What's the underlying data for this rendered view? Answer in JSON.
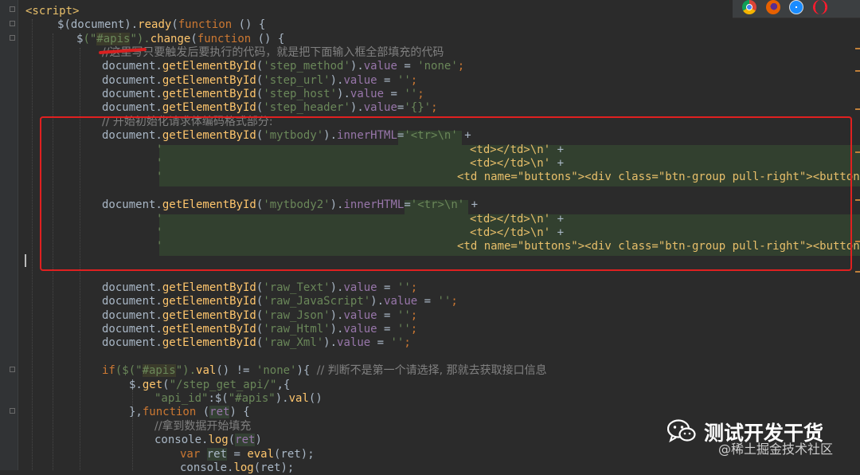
{
  "code": {
    "l1": {
      "tag": "<script>"
    },
    "l2": {
      "dollar": "$",
      "a": "(document).",
      "ready": "ready",
      "b": "(",
      "kw": "function",
      "c": " () {"
    },
    "l3": {
      "dollar": "$",
      "a": "(\"",
      "sel": "#apis",
      "b": "\").",
      "change": "change",
      "c": "(",
      "kw": "function",
      "d": " () {"
    },
    "l4": {
      "cmt": "//这里写只要触发后要执行的代码，就是把下面输入框全部填充的代码"
    },
    "l5": {
      "a": "document.",
      "fn": "getElementById",
      "b": "(",
      "s1": "'step_method'",
      "c": ").",
      "p": "value",
      "d": " = ",
      "s2": "'none'",
      "e": ";"
    },
    "l6": {
      "a": "document.",
      "fn": "getElementById",
      "b": "(",
      "s1": "'step_url'",
      "c": ").",
      "p": "value",
      "d": " = ",
      "s2": "''",
      "e": ";"
    },
    "l7": {
      "a": "document.",
      "fn": "getElementById",
      "b": "(",
      "s1": "'step_host'",
      "c": ").",
      "p": "value",
      "d": " = ",
      "s2": "''",
      "e": ";"
    },
    "l8": {
      "a": "document.",
      "fn": "getElementById",
      "b": "(",
      "s1": "'step_header'",
      "c": ").",
      "p": "value",
      "d": "=",
      "s2": "'{}'",
      "e": ";"
    },
    "l9": {
      "cmt": "// 开始初始化请求体编码格式部分:"
    },
    "l10": {
      "a": "document.",
      "fn": "getElementById",
      "b": "(",
      "s1": "'mytbody'",
      "c": ").",
      "p": "innerHTML",
      "d": "=",
      "s2": "'<tr>\\n'",
      "e": " +"
    },
    "l11": {
      "q": "'",
      "t": "<td></td>\\n'",
      "e": " +"
    },
    "l12": {
      "q": "'",
      "t": "<td></td>\\n'",
      "e": " +"
    },
    "l13": {
      "q": "'",
      "t": "<td name=\"buttons\"><div class=\"btn-group pull-right\"><button ic"
    },
    "l14": {
      "a": "document.",
      "fn": "getElementById",
      "b": "(",
      "s1": "'mytbody2'",
      "c": ").",
      "p": "innerHTML",
      "d": "=",
      "s2": "'<tr>\\n'",
      "e": " +"
    },
    "l15": {
      "q": "'",
      "t": "<td></td>\\n'",
      "e": " +"
    },
    "l16": {
      "q": "'",
      "t": "<td></td>\\n'",
      "e": " +"
    },
    "l17": {
      "q": "'",
      "t": "<td name=\"buttons\"><div class=\"btn-group pull-right\"><button ic"
    },
    "l18": {
      "a": "document.",
      "fn": "getElementById",
      "b": "(",
      "s1": "'raw_Text'",
      "c": ").",
      "p": "value",
      "d": " = ",
      "s2": "''",
      "e": ";"
    },
    "l19": {
      "a": "document.",
      "fn": "getElementById",
      "b": "(",
      "s1": "'raw_JavaScript'",
      "c": ").",
      "p": "value",
      "d": " = ",
      "s2": "''",
      "e": ";"
    },
    "l20": {
      "a": "document.",
      "fn": "getElementById",
      "b": "(",
      "s1": "'raw_Json'",
      "c": ").",
      "p": "value",
      "d": " = ",
      "s2": "''",
      "e": ";"
    },
    "l21": {
      "a": "document.",
      "fn": "getElementById",
      "b": "(",
      "s1": "'raw_Html'",
      "c": ").",
      "p": "value",
      "d": " = ",
      "s2": "''",
      "e": ";"
    },
    "l22": {
      "a": "document.",
      "fn": "getElementById",
      "b": "(",
      "s1": "'raw_Xml'",
      "c": ").",
      "p": "value",
      "d": " = ",
      "s2": "''",
      "e": ";"
    },
    "l23": {
      "kw": "if",
      "a": "($(\"",
      "sel": "#apis",
      "b": "\").",
      "fn": "val",
      "c": "() != ",
      "s": "'none'",
      "d": "){ ",
      "cmt": "// 判断不是第一个请选择, 那就去获取接口信息"
    },
    "l24": {
      "a": "$.",
      "fn": "get",
      "b": "(",
      "s": "\"/step_get_api/\"",
      "c": ",{"
    },
    "l25": {
      "s1": "\"api_id\"",
      "a": ":$(",
      "s2": "\"#apis\"",
      "b": ").",
      "fn": "val",
      "c": "()"
    },
    "l26": {
      "a": "},",
      "kw": "function",
      "b": " (",
      "v": "ret",
      "c": ") {"
    },
    "l27": {
      "cmt": "//拿到数据开始填充"
    },
    "l28": {
      "a": "console.",
      "fn": "log",
      "b": "(",
      "v": "ret",
      "c": ")"
    },
    "l29": {
      "kw": "var",
      "sp": " ",
      "v": "ret",
      "a": " = ",
      "fn": "eval",
      "b": "(ret);"
    },
    "l30": {
      "a": "console.",
      "fn": "log",
      "b": "(ret);"
    }
  },
  "browser_icons": [
    "chrome-icon",
    "firefox-icon",
    "safari-icon",
    "opera-icon"
  ],
  "watermark": {
    "title": "测试开发干货",
    "subtitle": "@稀土掘金技术社区"
  },
  "colors": {
    "background": "#2b2b2b",
    "keyword": "#cc7832",
    "function": "#ffc66d",
    "string": "#6a8759",
    "comment": "#808080",
    "property": "#9876aa",
    "annotation_red": "#e02020"
  }
}
